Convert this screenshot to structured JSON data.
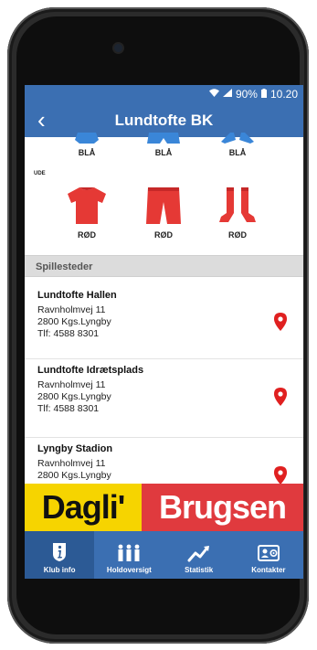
{
  "status": {
    "battery": "90%",
    "time": "10.20"
  },
  "header": {
    "back_symbol": "‹",
    "title": "Lundtofte BK"
  },
  "home_kit": {
    "shirt": "BLÅ",
    "shorts": "BLÅ",
    "socks": "BLÅ"
  },
  "away_kit": {
    "section_label": "UDE",
    "shirt": "RØD",
    "shorts": "RØD",
    "socks": "RØD"
  },
  "colors": {
    "nav": "#3b6fb2",
    "home_kit": "#3a86d8",
    "away_kit": "#e53935",
    "pin": "#e02020"
  },
  "venues_header": "Spillesteder",
  "venues": [
    {
      "name": "Lundtofte Hallen",
      "street": "Ravnholmvej 11",
      "city": "2800 Kgs.Lyngby",
      "phone": "Tlf: 4588 8301"
    },
    {
      "name": "Lundtofte Idrætsplads",
      "street": "Ravnholmvej 11",
      "city": "2800 Kgs.Lyngby",
      "phone": "Tlf: 4588 8301"
    },
    {
      "name": "Lyngby Stadion",
      "street": "Ravnholmvej 11",
      "city": "2800 Kgs.Lyngby"
    }
  ],
  "ad": {
    "left": "Dagli'",
    "right": "Brugsen"
  },
  "tabs": [
    {
      "label": "Klub info",
      "icon": "info-icon"
    },
    {
      "label": "Holdoversigt",
      "icon": "team-icon"
    },
    {
      "label": "Statistik",
      "icon": "chart-icon"
    },
    {
      "label": "Kontakter",
      "icon": "contact-card-icon"
    }
  ]
}
